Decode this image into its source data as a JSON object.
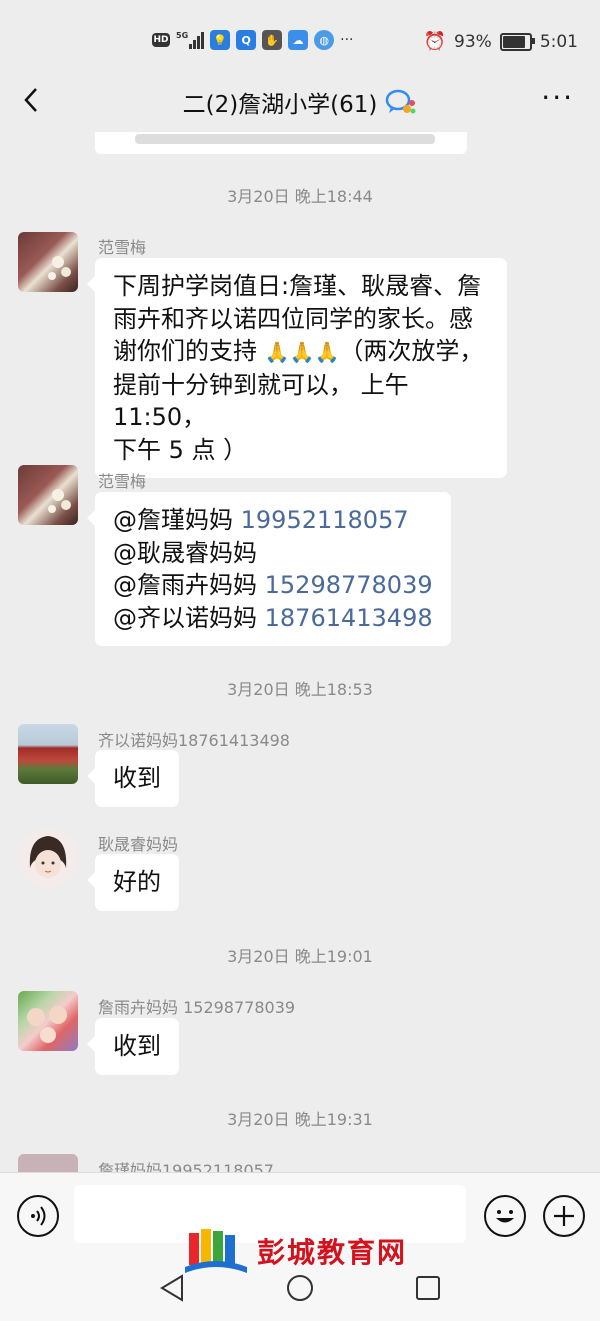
{
  "status_bar": {
    "net1": "HD",
    "net2": "5G",
    "battery": "93%",
    "battery_level": 0.93,
    "time": "5:01",
    "icons": [
      "hd-icon",
      "signal-icon",
      "app-icon-bulb",
      "app-icon-search",
      "app-icon-hand",
      "cloud-icon",
      "browser-icon",
      "more-dots-icon",
      "alarm-icon",
      "battery-icon"
    ]
  },
  "header": {
    "title": "二(2)詹湖小学(61)",
    "more_label": "···",
    "back_icon": "chevron-left-icon",
    "chat_icon": "group-chat-icon"
  },
  "messages": {
    "t1": "3月20日 晚上18:44",
    "m1": {
      "nick": "范雪梅",
      "line1": "下周护学岗值日:詹瑾、耿晟睿、詹",
      "line2": "雨卉和齐以诺四位同学的家长。感",
      "line3a": "谢你们的支持 ",
      "emoji": "🙏🙏🙏",
      "line3b": "（两次放学，",
      "line4": "提前十分钟到就可以， 上午 11:50，",
      "line5": "下午 5 点 ）"
    },
    "m2": {
      "nick": "范雪梅",
      "r1a": "@詹瑾妈妈 ",
      "r1b": "19952118057",
      "r2a": "@耿晟睿妈妈",
      "r3a": "@詹雨卉妈妈 ",
      "r3b": "15298778039",
      "r4a": "@齐以诺妈妈 ",
      "r4b": "18761413498"
    },
    "t2": "3月20日 晚上18:53",
    "m3": {
      "nick": "齐以诺妈妈18761413498",
      "text": "收到"
    },
    "m4": {
      "nick": "耿晟睿妈妈",
      "text": "好的"
    },
    "t3": "3月20日 晚上19:01",
    "m5": {
      "nick": "詹雨卉妈妈 15298778039",
      "text": "收到"
    },
    "t4": "3月20日 晚上19:31",
    "m6": {
      "nick": "詹瑾妈妈19952118057"
    }
  },
  "bottom": {
    "voice_icon": "voice-icon",
    "emoji_icon": "emoji-icon",
    "plus_icon": "plus-icon",
    "watermark": "彭城教育网",
    "nav": [
      "back-triangle-icon",
      "home-circle-icon",
      "recents-square-icon"
    ]
  },
  "colors": {
    "background": "#ededed",
    "bubble": "#ffffff",
    "phone_link": "#4a6a9b",
    "watermark": "#d2121d"
  }
}
